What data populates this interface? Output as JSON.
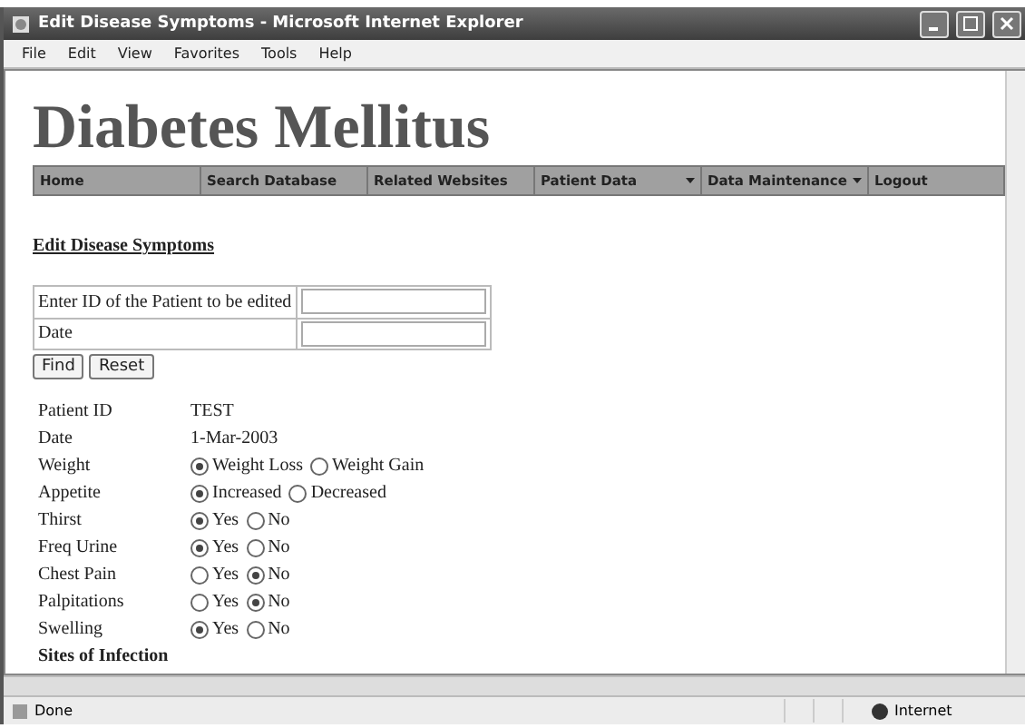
{
  "window": {
    "title": "Edit Disease Symptoms - Microsoft Internet Explorer"
  },
  "menu": [
    "File",
    "Edit",
    "View",
    "Favorites",
    "Tools",
    "Help"
  ],
  "page": {
    "heading": "Diabetes Mellitus",
    "nav": [
      {
        "label": "Home",
        "has_menu": false
      },
      {
        "label": "Search Database",
        "has_menu": false
      },
      {
        "label": "Related Websites",
        "has_menu": false
      },
      {
        "label": "Patient Data",
        "has_menu": true
      },
      {
        "label": "Data Maintenance",
        "has_menu": true
      },
      {
        "label": "Logout",
        "has_menu": false
      }
    ],
    "section_title": "Edit Disease Symptoms",
    "search_fields": [
      {
        "label": "Enter ID of the Patient to be edited"
      },
      {
        "label": "Date"
      }
    ],
    "buttons": [
      "Find",
      "Reset"
    ],
    "records": [
      {
        "kind": "text",
        "label": "Patient ID",
        "value": "TEST"
      },
      {
        "kind": "text",
        "label": "Date",
        "value": "1-Mar-2003"
      },
      {
        "kind": "radio",
        "label": "Weight",
        "options": [
          {
            "label": "Weight Loss",
            "selected": true
          },
          {
            "label": "Weight Gain",
            "selected": false
          }
        ]
      },
      {
        "kind": "radio",
        "label": "Appetite",
        "options": [
          {
            "label": "Increased",
            "selected": true
          },
          {
            "label": "Decreased",
            "selected": false
          }
        ]
      },
      {
        "kind": "radio",
        "label": "Thirst",
        "options": [
          {
            "label": "Yes",
            "selected": true
          },
          {
            "label": "No",
            "selected": false
          }
        ]
      },
      {
        "kind": "radio",
        "label": "Freq Urine",
        "options": [
          {
            "label": "Yes",
            "selected": true
          },
          {
            "label": "No",
            "selected": false
          }
        ]
      },
      {
        "kind": "radio",
        "label": "Chest Pain",
        "options": [
          {
            "label": "Yes",
            "selected": false
          },
          {
            "label": "No",
            "selected": true
          }
        ]
      },
      {
        "kind": "radio",
        "label": "Palpitations",
        "options": [
          {
            "label": "Yes",
            "selected": false
          },
          {
            "label": "No",
            "selected": true
          }
        ]
      },
      {
        "kind": "radio",
        "label": "Swelling",
        "options": [
          {
            "label": "Yes",
            "selected": true
          },
          {
            "label": "No",
            "selected": false
          }
        ]
      },
      {
        "kind": "heading",
        "label": "Sites of Infection"
      }
    ]
  },
  "status_bar": {
    "status": "Done",
    "zone": "Internet"
  }
}
